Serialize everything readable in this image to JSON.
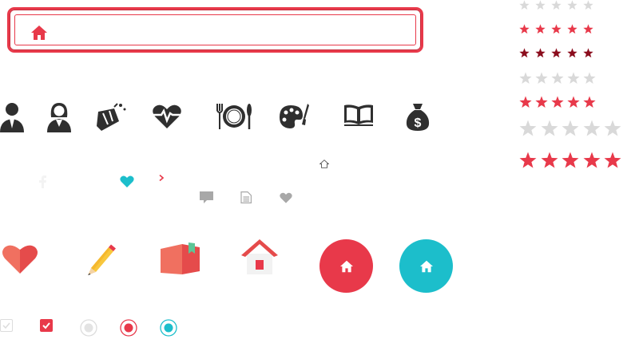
{
  "search_bar": {
    "icon": "home-icon",
    "value": ""
  },
  "people_icons": [
    "male-user-icon",
    "female-user-icon",
    "cleaning-icon",
    "heartbeat-icon",
    "dining-icon",
    "palette-icon",
    "book-icon",
    "money-bag-icon"
  ],
  "social_row": [
    "facebook-icon",
    "heart-icon",
    "chevron-right-icon",
    "home-outline-icon",
    "comment-icon",
    "document-icon",
    "heart-small-icon"
  ],
  "flat_icons": [
    "heart-flat-icon",
    "pencil-flat-icon",
    "book-flat-icon",
    "house-flat-icon"
  ],
  "buttons": [
    {
      "name": "home-button-red",
      "color": "#e8394a"
    },
    {
      "name": "home-button-teal",
      "color": "#1cbecb"
    }
  ],
  "controls": [
    {
      "name": "checkbox-unchecked",
      "checked": false
    },
    {
      "name": "checkbox-checked",
      "checked": true
    },
    {
      "name": "radio-unselected",
      "checked": false
    },
    {
      "name": "radio-selected-red",
      "checked": true
    },
    {
      "name": "radio-selected-teal",
      "checked": true
    }
  ],
  "ratings": [
    {
      "name": "rating-gray-small",
      "filled": 0,
      "max": 5,
      "color": "#d9d9d9"
    },
    {
      "name": "rating-red-small",
      "filled": 5,
      "max": 5,
      "color": "#e8394a"
    },
    {
      "name": "rating-darkred-small",
      "filled": 5,
      "max": 5,
      "color": "#8b0d1d"
    },
    {
      "name": "rating-gray-medium",
      "filled": 0,
      "max": 5,
      "color": "#d9d9d9"
    },
    {
      "name": "rating-red-medium",
      "filled": 5,
      "max": 5,
      "color": "#e8394a"
    },
    {
      "name": "rating-gray-large",
      "filled": 0,
      "max": 5,
      "color": "#d9d9d9"
    },
    {
      "name": "rating-red-large",
      "filled": 5,
      "max": 5,
      "color": "#e8394a"
    }
  ],
  "colors": {
    "accent": "#e8394a",
    "teal": "#1cbecb",
    "dark": "#2f2f2f",
    "gray": "#a8a8a8"
  }
}
